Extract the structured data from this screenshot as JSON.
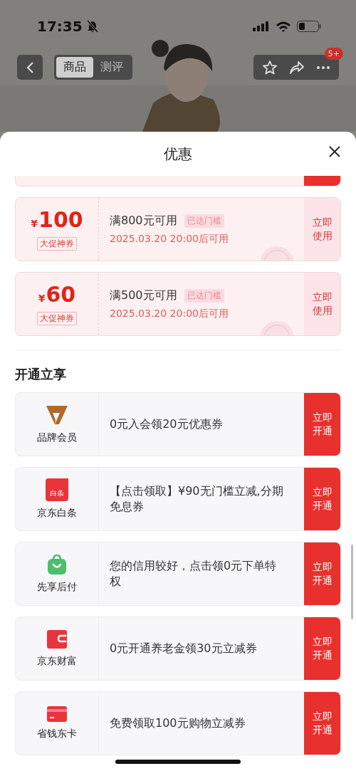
{
  "status_bar": {
    "time": "17:35",
    "muted": true
  },
  "nav": {
    "tabs": [
      {
        "label": "商品",
        "selected": true
      },
      {
        "label": "测评",
        "selected": false
      }
    ],
    "badge": "5+"
  },
  "sheet": {
    "title": "优惠"
  },
  "coupons": [
    {
      "currency": "¥",
      "amount": "100",
      "tag": "大促神券",
      "condition": "满800元可用",
      "badge": "已达门槛",
      "time": "2025.03.20 20:00后可用",
      "action": "立即使用"
    },
    {
      "currency": "¥",
      "amount": "60",
      "tag": "大促神券",
      "condition": "满500元可用",
      "badge": "已达门槛",
      "time": "2025.03.20 20:00后可用",
      "action": "立即使用"
    }
  ],
  "section_title": "开通立享",
  "offers": [
    {
      "kind": "member",
      "name": "品牌会员",
      "text": "0元入会领20元优惠券",
      "action": "立即开通"
    },
    {
      "kind": "credit",
      "icon_text": "白条",
      "name": "京东白条",
      "text": "【点击领取】¥90无门槛立减,分期免息券",
      "action": "立即开通"
    },
    {
      "kind": "bag",
      "name": "先享后付",
      "text": "您的信用较好，点击领0元下单特权",
      "action": "立即开通"
    },
    {
      "kind": "wallet",
      "name": "京东财富",
      "text": "0元开通养老金领30元立减券",
      "action": "立即开通"
    },
    {
      "kind": "card",
      "name": "省钱东卡",
      "text": "免费领取100元购物立减券",
      "action": "立即开通"
    }
  ]
}
